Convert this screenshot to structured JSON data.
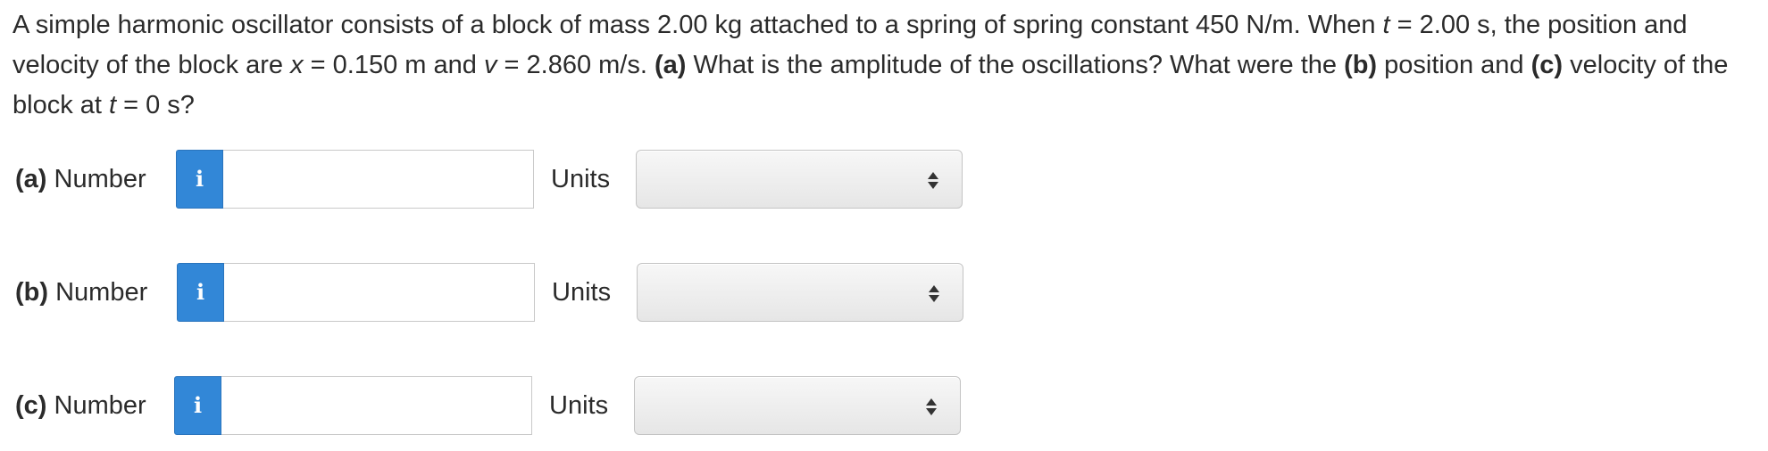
{
  "question": {
    "p1": "A simple harmonic oscillator consists of a block of mass 2.00 kg attached to a spring of spring constant 450 N/m. When ",
    "t1": "t",
    "p2": " = 2.00 s, the position and velocity of the block are ",
    "x": "x",
    "p3": " = 0.150 m and ",
    "v": "v",
    "p4": " = 2.860 m/s. ",
    "a_tag": "(a)",
    "p5": " What is the amplitude of the oscillations? What were the ",
    "b_tag": "(b)",
    "p6": " position and ",
    "c_tag": "(c)",
    "p7": " velocity of the block at ",
    "t2": "t",
    "p8": " = 0 s?"
  },
  "rows": [
    {
      "tag": "(a)",
      "label": " Number",
      "value": "",
      "units_label": "Units",
      "units_value": ""
    },
    {
      "tag": "(b)",
      "label": " Number",
      "value": "",
      "units_label": "Units",
      "units_value": ""
    },
    {
      "tag": "(c)",
      "label": " Number",
      "value": "",
      "units_label": "Units",
      "units_value": ""
    }
  ],
  "info_icon": {
    "name": "info-icon",
    "glyph": "i",
    "color": "#3287d7"
  }
}
